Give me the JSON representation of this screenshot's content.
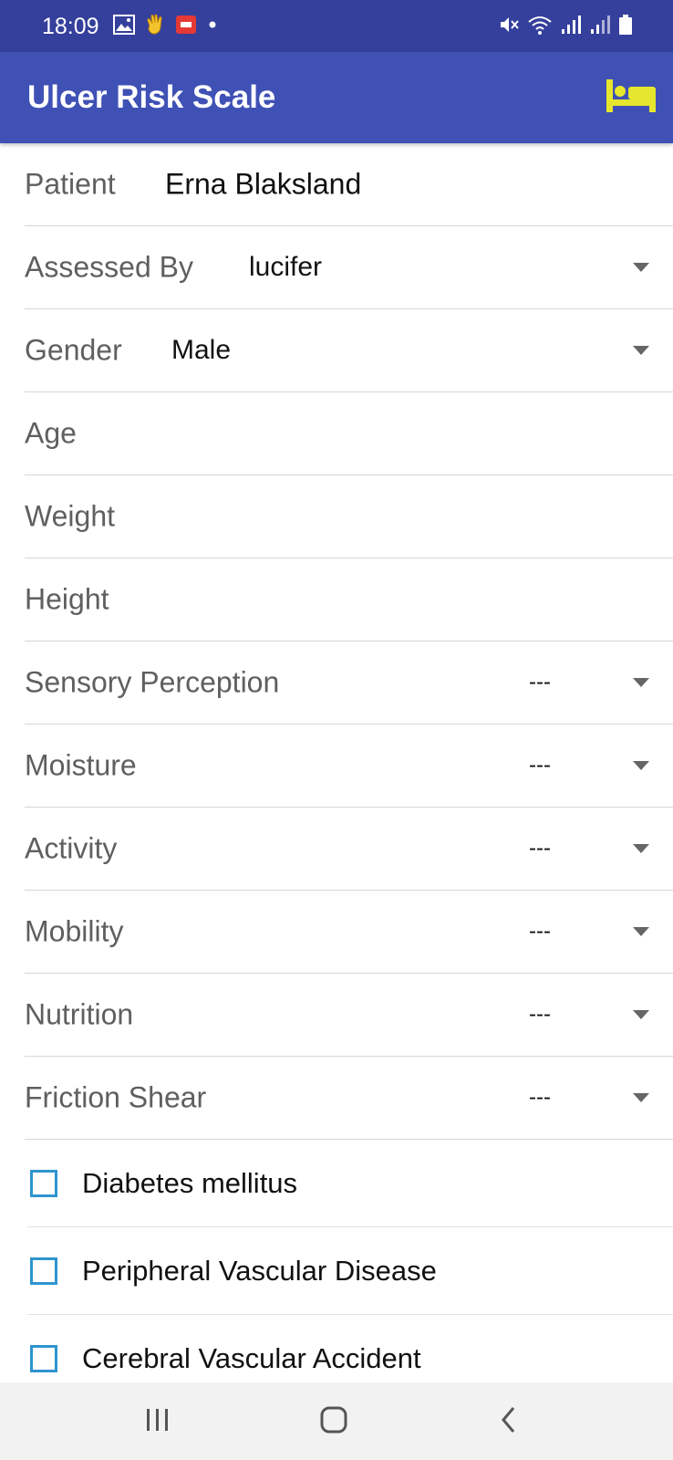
{
  "status_bar": {
    "time": "18:09",
    "left_icons": [
      "image-icon",
      "waving-hand-icon",
      "app-notification-icon",
      "dot-icon"
    ],
    "right_icons": [
      "mute-icon",
      "wifi-icon",
      "signal-icon",
      "signal-icon",
      "battery-icon"
    ]
  },
  "app_bar": {
    "title": "Ulcer Risk Scale",
    "action_icon": "bed-icon",
    "action_color": "#e6e62e",
    "background": "#3f51b5"
  },
  "form": {
    "patient": {
      "label": "Patient",
      "value": "Erna Blaksland"
    },
    "assessed_by": {
      "label": "Assessed By",
      "value": "lucifer"
    },
    "gender": {
      "label": "Gender",
      "value": "Male"
    },
    "age": {
      "label": "Age",
      "placeholder": ""
    },
    "weight": {
      "label": "Weight",
      "placeholder": ""
    },
    "height": {
      "label": "Height",
      "placeholder": ""
    },
    "sensory_perception": {
      "label": "Sensory Perception",
      "value": "---"
    },
    "moisture": {
      "label": "Moisture",
      "value": "---"
    },
    "activity": {
      "label": "Activity",
      "value": "---"
    },
    "mobility": {
      "label": "Mobility",
      "value": "---"
    },
    "nutrition": {
      "label": "Nutrition",
      "value": "---"
    },
    "friction_shear": {
      "label": "Friction Shear",
      "value": "---"
    }
  },
  "conditions": [
    {
      "label": "Diabetes mellitus",
      "checked": false
    },
    {
      "label": "Peripheral Vascular Disease",
      "checked": false
    },
    {
      "label": "Cerebral Vascular Accident",
      "checked": false
    }
  ],
  "colors": {
    "status_bar": "#35409c",
    "checkbox_border": "#2e95cf"
  },
  "nav_bar": {
    "buttons": [
      "recent-apps-icon",
      "home-icon",
      "back-icon"
    ]
  }
}
